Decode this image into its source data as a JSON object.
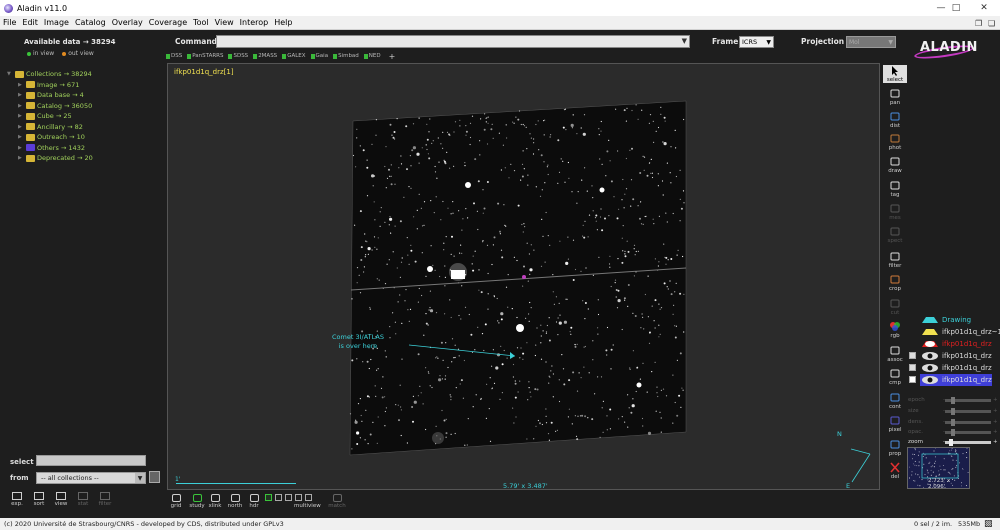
{
  "window": {
    "title": "Aladin v11.0",
    "min_icon": "minimize-icon",
    "max_icon": "maximize-icon",
    "close_icon": "close-icon"
  },
  "menubar": {
    "items": [
      "File",
      "Edit",
      "Image",
      "Catalog",
      "Overlay",
      "Coverage",
      "Tool",
      "View",
      "Interop",
      "Help"
    ]
  },
  "data_panel": {
    "available": "Available data → 38294",
    "in_view": "in view",
    "out_view": "out view",
    "tree": [
      {
        "label": "Collections → 38294",
        "color": "yellow"
      },
      {
        "label": "Image → 671",
        "color": "yellow"
      },
      {
        "label": "Data base → 4",
        "color": "yellow"
      },
      {
        "label": "Catalog → 36050",
        "color": "yellow"
      },
      {
        "label": "Cube → 25",
        "color": "yellow"
      },
      {
        "label": "Ancillary → 82",
        "color": "yellow"
      },
      {
        "label": "Outreach → 10",
        "color": "yellow"
      },
      {
        "label": "Others → 1432",
        "color": "purple"
      },
      {
        "label": "Deprecated → 20",
        "color": "yellow"
      }
    ],
    "select_label": "select",
    "from_label": "from",
    "from_value": "-- all collections --",
    "tools": [
      "exp.",
      "sort",
      "view",
      "stat",
      "filter"
    ]
  },
  "command": {
    "label": "Command",
    "value": ""
  },
  "frame": {
    "label": "Frame",
    "value": "ICRS"
  },
  "projection": {
    "label": "Projection",
    "value": "Mol"
  },
  "logo": {
    "text": "ALADIN"
  },
  "surveys": [
    "DSS",
    "PanSTARRS",
    "SDSS",
    "2MASS",
    "GALEX",
    "Gaia",
    "Simbad",
    "NED"
  ],
  "view": {
    "image_label": "ifkp01d1q_drz[1]",
    "annotation_line1": "Comet 3I/ATLAS",
    "annotation_line2": "is over here",
    "fov": "5.79' x 3.487'",
    "scale": "1'",
    "compass_n": "N",
    "compass_e": "E"
  },
  "bottom_tools": [
    "grid",
    "study",
    "xlink",
    "north",
    "hdr"
  ],
  "bottom_tools_disabled": [
    "match"
  ],
  "multiview_label": "multiview",
  "right_tools": [
    {
      "label": "select",
      "icon": "cursor-icon",
      "selected": true
    },
    {
      "label": "pan",
      "icon": "hand-icon"
    },
    {
      "label": "dist",
      "icon": "ruler-icon"
    },
    {
      "label": "phot",
      "icon": "photometry-icon"
    },
    {
      "label": "draw",
      "icon": "pencil-icon"
    },
    {
      "label": "tag",
      "icon": "tag-icon"
    },
    {
      "label": "mes",
      "icon": "measure-icon",
      "disabled": true
    },
    {
      "label": "spect",
      "icon": "spectrum-icon",
      "disabled": true
    },
    {
      "label": "filter",
      "icon": "filter-icon"
    },
    {
      "label": "crop",
      "icon": "crop-icon"
    },
    {
      "label": "cut",
      "icon": "cut-icon",
      "disabled": true
    },
    {
      "label": "rgb",
      "icon": "rgb-icon"
    },
    {
      "label": "assoc",
      "icon": "assoc-icon"
    },
    {
      "label": "cmp",
      "icon": "contrast-icon"
    },
    {
      "label": "cont",
      "icon": "contour-icon"
    },
    {
      "label": "pixel",
      "icon": "pixel-icon"
    },
    {
      "label": "prop",
      "icon": "properties-icon"
    },
    {
      "label": "del",
      "icon": "delete-icon"
    }
  ],
  "layers": [
    {
      "name": "Drawing",
      "color": "#3cd0d8"
    },
    {
      "name": "ifkp01d1q_drz~1",
      "color": "#dddddd"
    },
    {
      "name": "ifkp01d1q_drz",
      "color": "#e02020"
    },
    {
      "name": "ifkp01d1q_drz",
      "color": "#dddddd"
    },
    {
      "name": "ifkp01d1q_drz",
      "color": "#dddddd"
    },
    {
      "name": "ifkp01d1q_drz",
      "color": "#dddddd",
      "highlight": true
    }
  ],
  "sliders": [
    {
      "label": "epoch",
      "active": false
    },
    {
      "label": "size",
      "active": false
    },
    {
      "label": "dens.",
      "active": false
    },
    {
      "label": "opac.",
      "active": false
    },
    {
      "label": "zoom",
      "active": true
    }
  ],
  "minimap": {
    "text": "2.723' x 2.096'"
  },
  "statusbar": {
    "copyright": "(c) 2020 Université de Strasbourg/CNRS - developed by CDS, distributed under GPLv3",
    "memory": "0 sel / 2 im.",
    "mb": "535Mb"
  },
  "colors": {
    "accent_green": "#a2d25c",
    "annotation_cyan": "#3cd0d8",
    "label_yellow": "#f0e050",
    "logo_magenta": "#c53ac2"
  }
}
